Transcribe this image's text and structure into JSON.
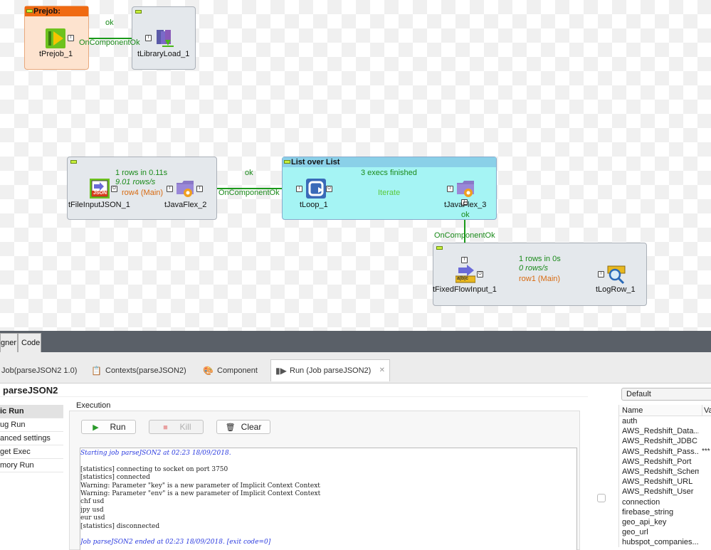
{
  "canvas": {
    "prejob_box_title": "Prejob:",
    "list_box_title": "List over List",
    "components": {
      "tPrejob_1": "tPrejob_1",
      "tLibraryLoad_1": "tLibraryLoad_1",
      "tFileInputJSON_1": "tFileInputJSON_1",
      "tJavaFlex_2": "tJavaFlex_2",
      "tLoop_1": "tLoop_1",
      "tJavaFlex_3": "tJavaFlex_3",
      "tFixedFlowInput_1": "tFixedFlowInput_1",
      "tLogRow_1": "tLogRow_1"
    },
    "links": {
      "ok_1": "ok",
      "oncomp_1": "OnComponentOk",
      "stats_1": "1 rows in 0.11s",
      "rate_1": "9.01 rows/s",
      "row4": "row4 (Main)",
      "ok_2": "ok",
      "oncomp_2": "OnComponentOk",
      "execs": "3 execs finished",
      "iterate": "Iterate",
      "ok_3": "ok",
      "oncomp_3": "OnComponentOk",
      "stats_2": "1 rows in 0s",
      "rate_2": "0 rows/s",
      "row1": "row1 (Main)"
    },
    "json_badge": "JSON",
    "fixed_badge": "a|b|c"
  },
  "editor_tabs": {
    "designer": "gner",
    "code": "Code"
  },
  "view_tabs": [
    {
      "label": "Job(parseJSON2 1.0)"
    },
    {
      "label": "Contexts(parseJSON2)"
    },
    {
      "label": "Component"
    },
    {
      "label": "Run (Job parseJSON2)"
    }
  ],
  "run_panel": {
    "title": "parseJSON2",
    "side_items": [
      "ic Run",
      "ug Run",
      "anced settings",
      "get Exec",
      "mory Run"
    ],
    "execution_label": "Execution",
    "buttons": {
      "run": "Run",
      "kill": "Kill",
      "clear": "Clear"
    },
    "console_lines": [
      "Starting job parseJSON2 at 02:23 18/09/2018.",
      "",
      "[statistics] connecting to socket on port 3750",
      "[statistics] connected",
      "Warning: Parameter \"key\" is a new parameter of Implicit Context Context",
      "Warning: Parameter \"env\" is a new parameter of Implicit Context Context",
      "chf usd",
      "jpy usd",
      "eur usd",
      "[statistics] disconnected",
      "",
      "Job parseJSON2 ended at 02:23 18/09/2018. [exit code=0]"
    ]
  },
  "context_panel": {
    "selected_context": "Default",
    "col_name": "Name",
    "col_value": "Va",
    "rows": [
      {
        "name": "auth",
        "value": ""
      },
      {
        "name": "AWS_Redshift_Data...",
        "value": ""
      },
      {
        "name": "AWS_Redshift_JDBC",
        "value": ""
      },
      {
        "name": "AWS_Redshift_Pass...",
        "value": "***"
      },
      {
        "name": "AWS_Redshift_Port",
        "value": ""
      },
      {
        "name": "AWS_Redshift_Schema",
        "value": ""
      },
      {
        "name": "AWS_Redshift_URL",
        "value": ""
      },
      {
        "name": "AWS_Redshift_User",
        "value": ""
      },
      {
        "name": "connection",
        "value": ""
      },
      {
        "name": "firebase_string",
        "value": ""
      },
      {
        "name": "geo_api_key",
        "value": ""
      },
      {
        "name": "geo_url",
        "value": ""
      },
      {
        "name": "hubspot_companies...",
        "value": ""
      }
    ]
  }
}
